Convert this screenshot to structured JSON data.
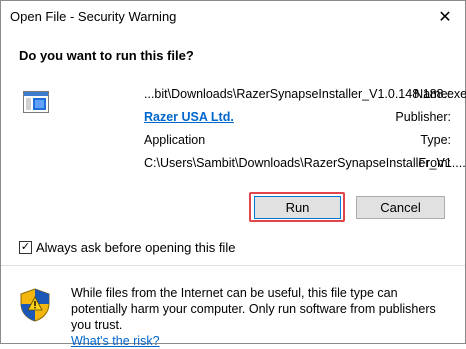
{
  "window": {
    "title": "Open File - Security Warning",
    "close_glyph": "✕"
  },
  "question": "Do you want to run this file?",
  "file": {
    "name_label": "Name:",
    "name_value": "...bit\\Downloads\\RazerSynapseInstaller_V1.0.148.188.exe",
    "publisher_label": "Publisher:",
    "publisher_value": "Razer USA Ltd.",
    "type_label": "Type:",
    "type_value": "Application",
    "from_label": "From:",
    "from_value": "C:\\Users\\Sambit\\Downloads\\RazerSynapseInstaller_V1...."
  },
  "buttons": {
    "run": "Run",
    "cancel": "Cancel"
  },
  "checkbox": {
    "label": "Always ask before opening this file",
    "checked": true,
    "check_glyph": "✓"
  },
  "warning": {
    "text": "While files from the Internet can be useful, this file type can potentially harm your computer. Only run software from publishers you trust.",
    "link": "What's the risk?"
  },
  "icons": {
    "file": "application-file-icon",
    "shield": "security-shield-icon"
  },
  "colors": {
    "link": "#0066cc",
    "highlight": "#e0454b",
    "focus_border": "#0078d7"
  }
}
